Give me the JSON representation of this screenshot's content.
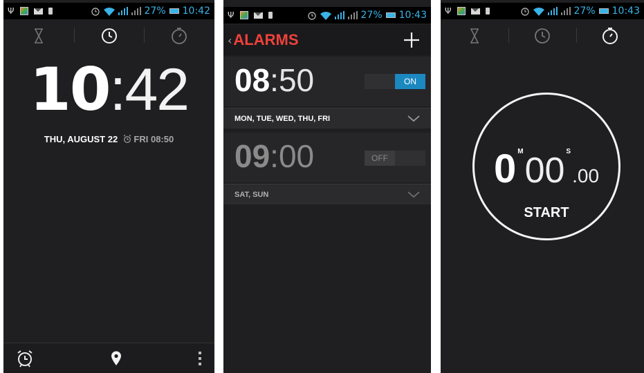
{
  "status": [
    {
      "battery": "27%",
      "time": "10:42"
    },
    {
      "battery": "27%",
      "time": "10:43"
    },
    {
      "battery": "27%",
      "time": "10:43"
    }
  ],
  "clock": {
    "hour": "10",
    "separator": ":",
    "minute": "42",
    "date": "THU, AUGUST 22",
    "next_alarm": "FRI 08:50"
  },
  "alarms": {
    "title": "ALARMS",
    "items": [
      {
        "hour": "08",
        "separator": ":",
        "minute": "50",
        "state": "ON",
        "days": "MON, TUE, WED, THU, FRI"
      },
      {
        "hour": "09",
        "separator": ":",
        "minute": "00",
        "state": "OFF",
        "days": "SAT, SUN"
      }
    ]
  },
  "stopwatch": {
    "minutes": "0",
    "minute_unit": "M",
    "seconds": "00",
    "second_unit": "S",
    "hundredths": ".00",
    "start_label": "START"
  },
  "colors": {
    "accent_red": "#f0413b",
    "accent_blue": "#1b88c0",
    "status_blue": "#3ab3e6",
    "background": "#1f1f21"
  },
  "icons": {
    "tabs": [
      "timer-hourglass-icon",
      "clock-icon",
      "stopwatch-icon"
    ],
    "bottom_bar": [
      "alarm-clock-icon",
      "map-pin-icon",
      "overflow-menu-icon"
    ]
  }
}
